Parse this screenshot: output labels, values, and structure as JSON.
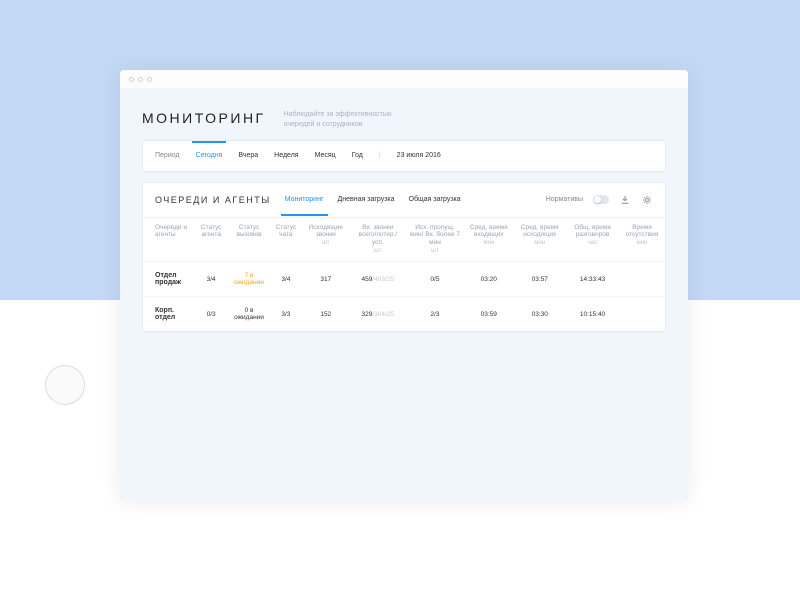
{
  "header": {
    "title": "МОНИТОРИНГ",
    "subtitle": "Наблюдайте за эффективностью очередей и сотрудников"
  },
  "period": {
    "label": "Период",
    "items": [
      "Сегодня",
      "Вчера",
      "Неделя",
      "Месяц",
      "Год"
    ],
    "activeIndex": 0,
    "date": "23 июля 2016"
  },
  "section": {
    "title": "ОЧЕРЕДИ И АГЕНТЫ",
    "tabs": [
      "Мониторинг",
      "Дневная загрузка",
      "Общая загрузка"
    ],
    "activeTab": 0,
    "norm_label": "Нормативы"
  },
  "columns": [
    {
      "l": "Очереди и агенты",
      "u": ""
    },
    {
      "l": "Статус агента",
      "u": ""
    },
    {
      "l": "Статус вызовов",
      "u": ""
    },
    {
      "l": "Статус чата",
      "u": ""
    },
    {
      "l": "Исходящие звонки",
      "u": "шт"
    },
    {
      "l": "Вх. звонки всего/потер./усп.",
      "u": "шт."
    },
    {
      "l": "Исх. пропущ. мин/ Вх. более 7 мин",
      "u": "шт"
    },
    {
      "l": "Сред. время входящих",
      "u": "мин"
    },
    {
      "l": "Сред. время исходящих",
      "u": "мин"
    },
    {
      "l": "Общ. время разговоров",
      "u": "час"
    },
    {
      "l": "Время отсутствия",
      "u": "мин"
    }
  ],
  "rows": [
    {
      "name": "Отдел продаж",
      "agent": "3/4",
      "calls": "7 в ожидании",
      "calls_warn": true,
      "chat": "3/4",
      "out": "317",
      "in_a": "459",
      "in_b": "/403/25",
      "missed": "0/5",
      "avg_in": "03:20",
      "avg_out": "03:57",
      "total": "14:33:43",
      "absent": ""
    },
    {
      "name": "Корп. отдел",
      "agent": "0/3",
      "calls": "0 в ожидании",
      "calls_warn": false,
      "chat": "3/3",
      "out": "152",
      "in_a": "329",
      "in_b": "/304/25",
      "missed": "2/3",
      "avg_in": "03:59",
      "avg_out": "03:30",
      "total": "10:15:40",
      "absent": ""
    }
  ]
}
